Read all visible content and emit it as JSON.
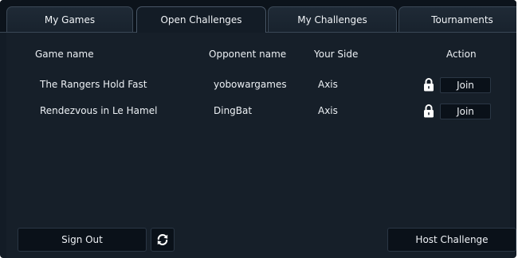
{
  "tabs": [
    {
      "label": "My Games"
    },
    {
      "label": "Open Challenges",
      "active": true
    },
    {
      "label": "My Challenges"
    },
    {
      "label": "Tournaments"
    }
  ],
  "table": {
    "headers": {
      "game_name": "Game name",
      "opponent_name": "Opponent name",
      "your_side": "Your Side",
      "action": "Action"
    },
    "rows": [
      {
        "game": "The Rangers Hold Fast",
        "opponent": "yobowargames",
        "side": "Axis",
        "action": "Join",
        "locked": true
      },
      {
        "game": "Rendezvous in Le Hamel",
        "opponent": "DingBat",
        "side": "Axis",
        "action": "Join",
        "locked": true
      }
    ]
  },
  "footer": {
    "sign_out": "Sign Out",
    "refresh_icon": "refresh-icon",
    "host_challenge": "Host Challenge"
  },
  "colors": {
    "background": "#131c26",
    "panel": "#161f29",
    "button": "#0a1119",
    "border": "#3b4856",
    "text": "#ecf0f4"
  }
}
